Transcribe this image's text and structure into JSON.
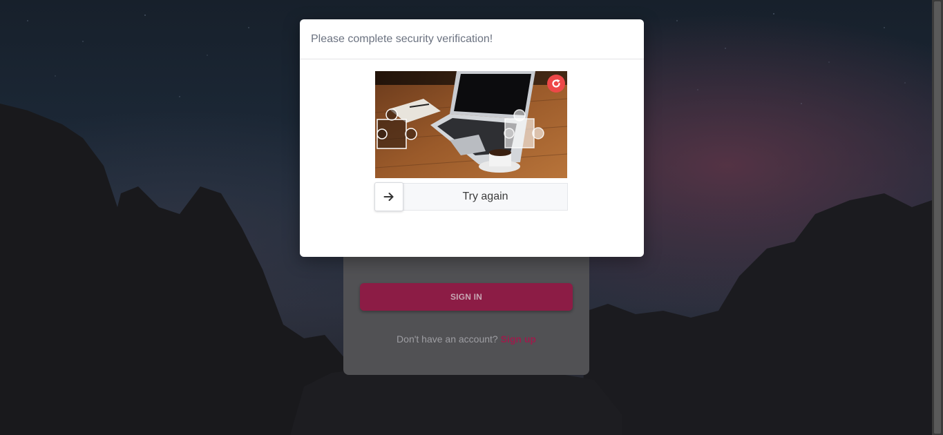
{
  "modal": {
    "title": "Please complete security verification!",
    "slider_text": "Try again",
    "icons": {
      "refresh": "refresh-icon",
      "slider_handle": "arrow-right-icon"
    }
  },
  "login": {
    "signin_label": "SIGN IN",
    "signup_prompt": "Don't have an account?",
    "signup_link": "Sign up"
  },
  "colors": {
    "accent": "#e91e63",
    "refresh": "#ee4848"
  }
}
